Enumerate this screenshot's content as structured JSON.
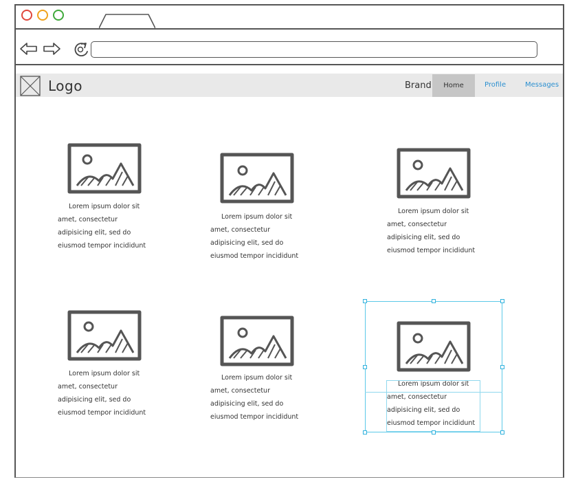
{
  "browser": {
    "url": ""
  },
  "header": {
    "logo_text": "Logo",
    "brand": "Brand",
    "nav": {
      "home": "Home",
      "profile": "Profile",
      "messages": "Messages"
    }
  },
  "cards": [
    {
      "lines": [
        "Lorem ipsum dolor sit",
        "amet, consectetur",
        "adipisicing elit, sed do",
        "eiusmod tempor incididunt"
      ]
    },
    {
      "lines": [
        "Lorem ipsum dolor sit",
        "amet, consectetur",
        "adipisicing elit, sed do",
        "eiusmod tempor incididunt"
      ]
    },
    {
      "lines": [
        "Lorem ipsum dolor sit",
        "amet, consectetur",
        "adipisicing elit, sed do",
        "eiusmod tempor incididunt"
      ]
    },
    {
      "lines": [
        "Lorem ipsum dolor sit",
        "amet, consectetur",
        "adipisicing elit, sed do",
        "eiusmod tempor incididunt"
      ]
    },
    {
      "lines": [
        "Lorem ipsum dolor sit",
        "amet, consectetur",
        "adipisicing elit, sed do",
        "eiusmod tempor incididunt"
      ]
    },
    {
      "lines": [
        "Lorem ipsum dolor sit",
        "amet, consectetur",
        "adipisicing elit, sed do",
        "eiusmod tempor incididunt"
      ]
    }
  ],
  "colors": {
    "close": "#e0463b",
    "minimize": "#f0a21c",
    "maximize": "#3fa93a",
    "link": "#2b8fd0",
    "selection": "#2fb1dd",
    "header_bg": "#e9e9e9",
    "active_nav_bg": "#c6c6c6"
  },
  "icons": {
    "back": "arrow-left-icon",
    "forward": "arrow-right-icon",
    "reload": "reload-icon",
    "logo": "image-placeholder-icon",
    "card_image": "image-icon"
  }
}
